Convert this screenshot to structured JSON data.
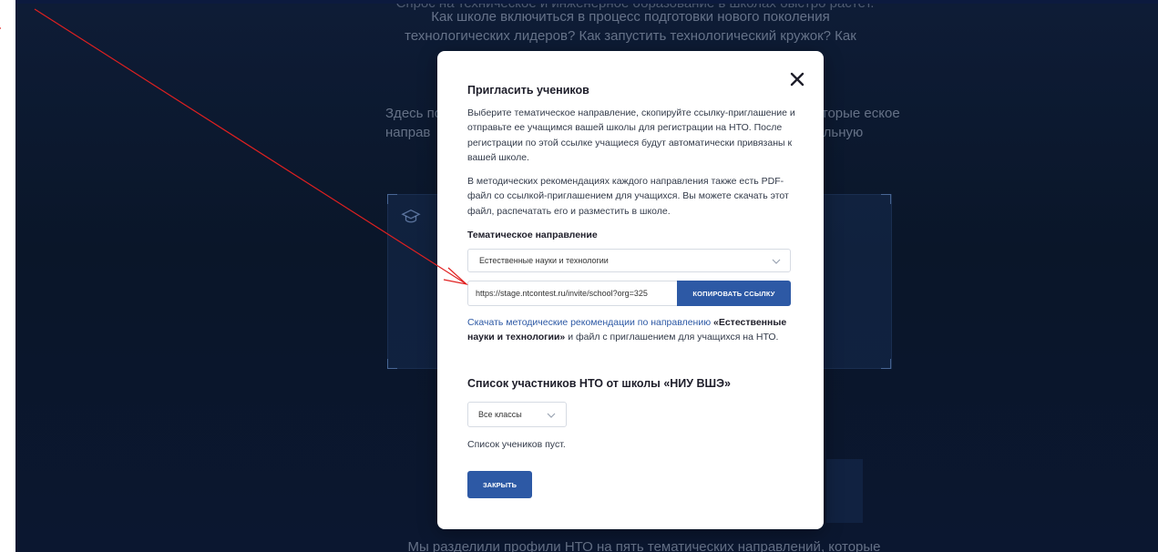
{
  "background": {
    "top_line": "Спрос на техническое и инженерное образование в школах быстро растёт.",
    "paragraph1": "Как школе включиться в процесс подготовки нового поколения технологических лидеров? Как запустить технологический кружок? Как",
    "paragraph2_left": "Здесь по направ",
    "paragraph2_right": "которые еское нальную",
    "bottom_text": "Мы разделили профили НТО на пять тематических направлений, которые"
  },
  "modal": {
    "title": "Пригласить учеников",
    "description1": "Выберите тематическое направление, скопируйте ссылку-приглашение и отправьте ее учащимся вашей школы для регистрации на НТО. После регистрации по этой ссылке учащиеся будут автоматически привязаны к вашей школе.",
    "description2": "В методических рекомендациях каждого направления также есть PDF-файл со ссылкой-приглашением для учащихся. Вы можете скачать этот файл, распечатать его и разместить в школе.",
    "direction_label": "Тематическое направление",
    "direction_value": "Естественные науки и технологии",
    "invite_link": "https://stage.ntcontest.ru/invite/school?org=325",
    "copy_button": "КОПИРОВАТЬ ССЫЛКУ",
    "download_link_text": "Скачать методические рекомендации по направлению",
    "download_direction": "«Естественные науки и технологии»",
    "download_suffix": " и файл с приглашением для учащихся на НТО.",
    "participants_title": "Список участников НТО от школы «НИУ ВШЭ»",
    "class_filter_value": "Все классы",
    "empty_list_text": "Список учеников пуст.",
    "close_button": "ЗАКРЫТЬ"
  },
  "icons": {
    "close": "close-icon",
    "chevron": "chevron-down-icon",
    "background_card": "graduation-cap-icon"
  },
  "colors": {
    "accent": "#2d59a5",
    "annotation_arrow": "#e02020",
    "page_background": "#0b1730"
  }
}
